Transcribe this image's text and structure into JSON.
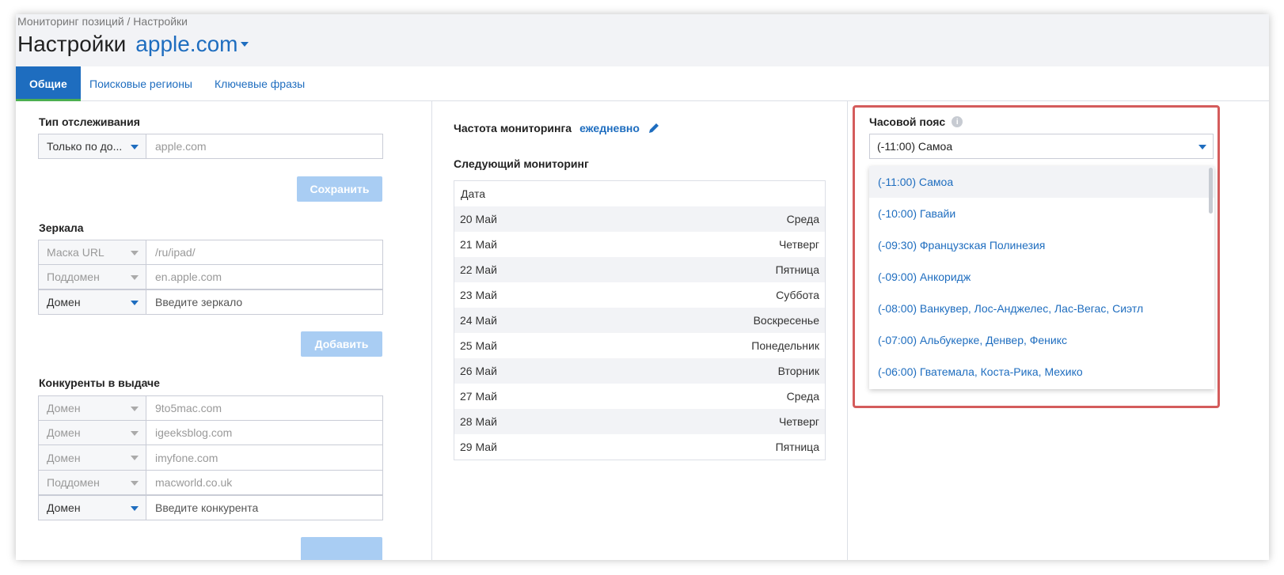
{
  "breadcrumb": "Мониторинг позиций / Настройки",
  "page_title": "Настройки",
  "domain": "apple.com",
  "tabs": [
    {
      "label": "Общие",
      "active": true
    },
    {
      "label": "Поисковые регионы",
      "active": false
    },
    {
      "label": "Ключевые фразы",
      "active": false
    }
  ],
  "tracking": {
    "label": "Тип отслеживания",
    "type_value": "Только по до...",
    "domain_placeholder": "apple.com",
    "save_button": "Сохранить"
  },
  "mirrors": {
    "label": "Зеркала",
    "rows": [
      {
        "type": "Маска URL",
        "value": "/ru/ipad/"
      },
      {
        "type": "Поддомен",
        "value": "en.apple.com"
      },
      {
        "type": "Домен",
        "value": "Введите зеркало"
      }
    ],
    "add_button": "Добавить"
  },
  "competitors": {
    "label": "Конкуренты в выдаче",
    "rows": [
      {
        "type": "Домен",
        "value": "9to5mac.com"
      },
      {
        "type": "Домен",
        "value": "igeeksblog.com"
      },
      {
        "type": "Домен",
        "value": "imyfone.com"
      },
      {
        "type": "Поддомен",
        "value": "macworld.co.uk"
      },
      {
        "type": "Домен",
        "value": "Введите конкурента"
      }
    ]
  },
  "monitoring": {
    "frequency_label": "Частота мониторинга",
    "frequency_value": "ежедневно",
    "next_label": "Следующий мониторинг",
    "table_header": "Дата",
    "rows": [
      {
        "date": "20 Май",
        "day": "Среда"
      },
      {
        "date": "21 Май",
        "day": "Четверг"
      },
      {
        "date": "22 Май",
        "day": "Пятница"
      },
      {
        "date": "23 Май",
        "day": "Суббота"
      },
      {
        "date": "24 Май",
        "day": "Воскресенье"
      },
      {
        "date": "25 Май",
        "day": "Понедельник"
      },
      {
        "date": "26 Май",
        "day": "Вторник"
      },
      {
        "date": "27 Май",
        "day": "Среда"
      },
      {
        "date": "28 Май",
        "day": "Четверг"
      },
      {
        "date": "29 Май",
        "day": "Пятница"
      }
    ]
  },
  "timezone": {
    "label": "Часовой пояс",
    "selected": "(-11:00) Самоа",
    "options": [
      "(-11:00) Самоа",
      "(-10:00) Гавайи",
      "(-09:30) Французская Полинезия",
      "(-09:00) Анкоридж",
      "(-08:00) Ванкувер, Лос-Анджелес, Лас-Вегас, Сиэтл",
      "(-07:00) Альбукерке, Денвер, Феникс",
      "(-06:00) Гватемала, Коста-Рика, Мехико"
    ]
  },
  "colors": {
    "accent": "#1e6dbf",
    "highlight_border": "#d45c5c",
    "active_tab_underline": "#4caf50",
    "disabled_button": "#a9cdf3"
  }
}
